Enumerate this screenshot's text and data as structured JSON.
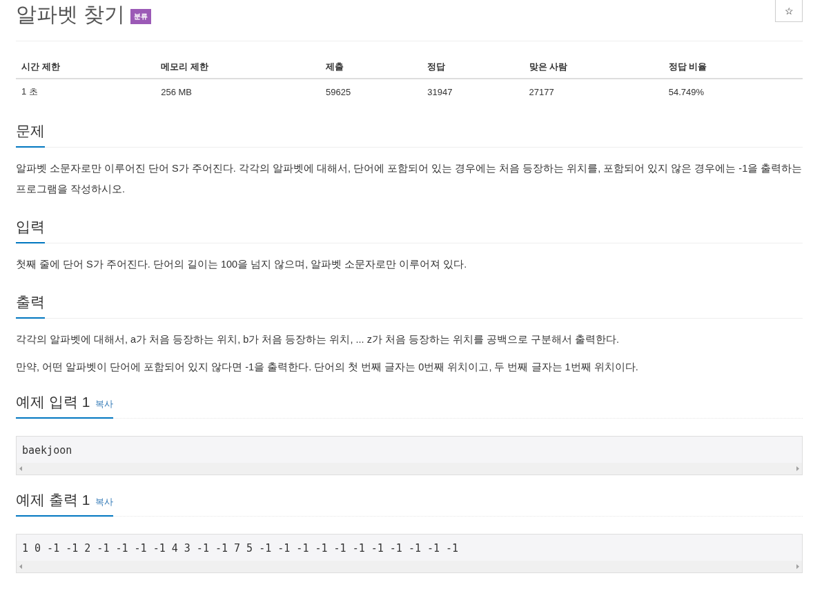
{
  "title": "알파벳 찾기",
  "badge": "분류",
  "star_button": "☆",
  "info_table": {
    "columns": [
      "시간 제한",
      "메모리 제한",
      "제출",
      "정답",
      "맞은 사람",
      "정답 비율"
    ],
    "rows": [
      [
        "1 초",
        "256 MB",
        "59625",
        "31947",
        "27177",
        "54.749%"
      ]
    ]
  },
  "sections": [
    {
      "heading": "문제",
      "paragraphs": [
        "알파벳 소문자로만 이루어진 단어 S가 주어진다. 각각의 알파벳에 대해서, 단어에 포함되어 있는 경우에는 처음 등장하는 위치를, 포함되어 있지 않은 경우에는 -1을 출력하는 프로그램을 작성하시오."
      ]
    },
    {
      "heading": "입력",
      "paragraphs": [
        "첫째 줄에 단어 S가 주어진다. 단어의 길이는 100을 넘지 않으며, 알파벳 소문자로만 이루어져 있다."
      ]
    },
    {
      "heading": "출력",
      "paragraphs": [
        "각각의 알파벳에 대해서, a가 처음 등장하는 위치, b가 처음 등장하는 위치, ... z가 처음 등장하는 위치를 공백으로 구분해서 출력한다.",
        "만약, 어떤 알파벳이 단어에 포함되어 있지 않다면 -1을 출력한다. 단어의 첫 번째 글자는 0번째 위치이고, 두 번째 글자는 1번째 위치이다."
      ]
    }
  ],
  "samples": [
    {
      "heading": "예제 입력 1",
      "copy_link": "복사",
      "content": "baekjoon"
    },
    {
      "heading": "예제 출력 1",
      "copy_link": "복사",
      "content": "1 0 -1 -1 2 -1 -1 -1 -1 4 3 -1 -1 7 5 -1 -1 -1 -1 -1 -1 -1 -1 -1 -1 -1"
    }
  ]
}
